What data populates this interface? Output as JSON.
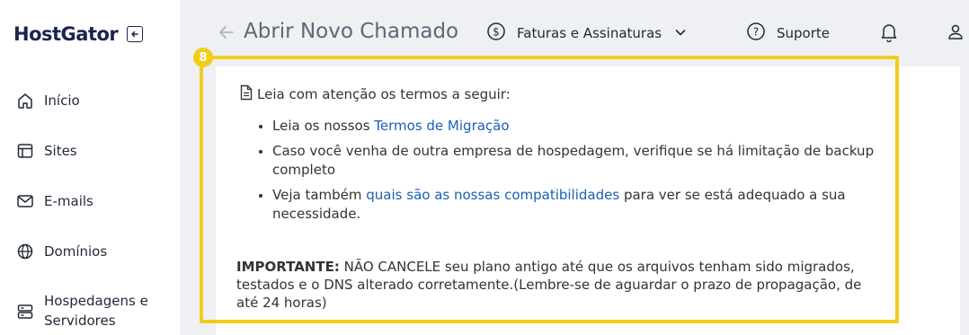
{
  "brand": {
    "logo_text": "HostGator"
  },
  "sidebar": {
    "items": [
      {
        "label": "Início",
        "icon": "home-icon"
      },
      {
        "label": "Sites",
        "icon": "window-icon"
      },
      {
        "label": "E-mails",
        "icon": "mail-icon"
      },
      {
        "label": "Domínios",
        "icon": "globe-icon"
      },
      {
        "label": "Hospedagens e Servidores",
        "icon": "server-icon"
      }
    ]
  },
  "header": {
    "title": "Abrir Novo Chamado",
    "billing_label": "Faturas e Assinaturas",
    "support_label": "Suporte"
  },
  "step_badge": "8",
  "terms": {
    "heading": "Leia com atenção os termos a seguir:",
    "item1_prefix": "Leia os nossos ",
    "item1_link": "Termos de Migração",
    "item2": "Caso você venha de outra empresa de hospedagem, verifique se há limitação de backup completo",
    "item3_prefix": "Veja também ",
    "item3_link": "quais são as nossas compatibilidades",
    "item3_suffix": " para ver se está adequado a sua necessidade."
  },
  "important": {
    "label": "IMPORTANTE:",
    "text": " NÃO CANCELE seu plano antigo até que os arquivos tenham sido migrados, testados e o DNS alterado corretamente.(Lembre-se de aguardar o prazo de propagação, de até 24 horas)"
  },
  "colors": {
    "accent": "#f2cc1b",
    "link": "#1a5fb4",
    "brand": "#1b2450"
  }
}
